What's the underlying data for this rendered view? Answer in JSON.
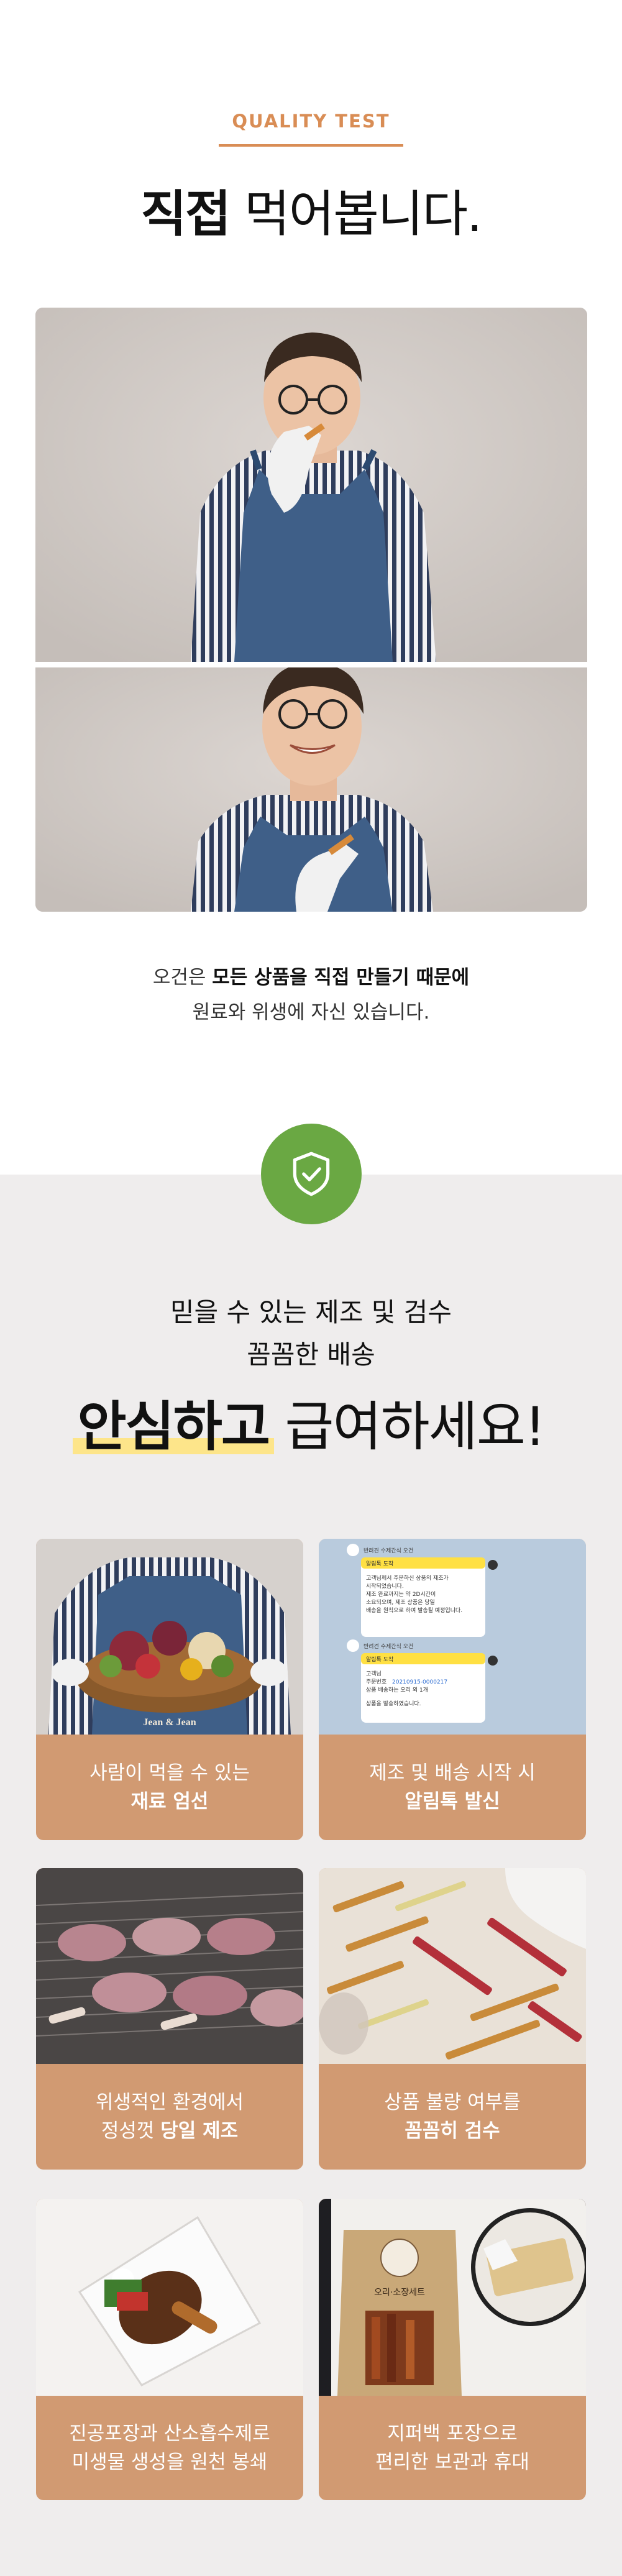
{
  "quality_section": {
    "eyebrow": "QUALITY TEST",
    "title_bold": "직접",
    "title_light": " 먹어봅니다.",
    "intro_line1_a": "오건은 ",
    "intro_line1_b": "모든 상품을 직접 만들기 때문에",
    "intro_line2": "원료와 위생에 자신 있습니다."
  },
  "trust_section": {
    "icon": "shield-check-icon",
    "accent_color": "#6aa843",
    "sub_line1": "믿을 수 있는 제조 및 검수",
    "sub_line2": "꼼꼼한 배송",
    "title_highlight": "안심하고",
    "title_rest": " 급여하세요!",
    "cards": [
      {
        "line1": "사람이 먹을 수 있는",
        "line2": "재료 엄선"
      },
      {
        "line1": "제조 및 배송 시작 시",
        "line2": "알림톡 발신"
      },
      {
        "line1": "위생적인 환경에서",
        "line2_a": "정성껏 ",
        "line2_b": "당일 제조"
      },
      {
        "line1": "상품 불량 여부를",
        "line2": "꼼꼼히 검수"
      },
      {
        "line1": "진공포장과 산소흡수제로",
        "line2": "미생물 생성을 원천 봉쇄"
      },
      {
        "line1": "지퍼백 포장으로",
        "line2": "편리한 보관과 휴대"
      }
    ],
    "card_color": "#d19a72"
  },
  "images": {
    "apron_text": "Jean & Jean",
    "chat": {
      "sender": "반려견 수제간식 오건",
      "head1": "알림톡 도착",
      "msg1_l1": "고객님께서 주문하신 상품의 제조가",
      "msg1_l2": "시작되었습니다.",
      "msg1_l3": "제조 완료까지는 약 2D시간이",
      "msg1_l4": "소요되오며, 제조 상품은 당일",
      "msg1_l5": "배송을 원칙으로 하여 발송될 예정입니다.",
      "head2": "알림톡 도착",
      "msg2_l1": "고객님",
      "msg2_l2": "주문번호",
      "msg2_order": "20210915-0000217",
      "msg2_l3": "상품 배송하는 오리 외 1개",
      "msg2_l4": "상품을 발송하였습니다."
    },
    "bag_label": "오리·소장세트"
  }
}
